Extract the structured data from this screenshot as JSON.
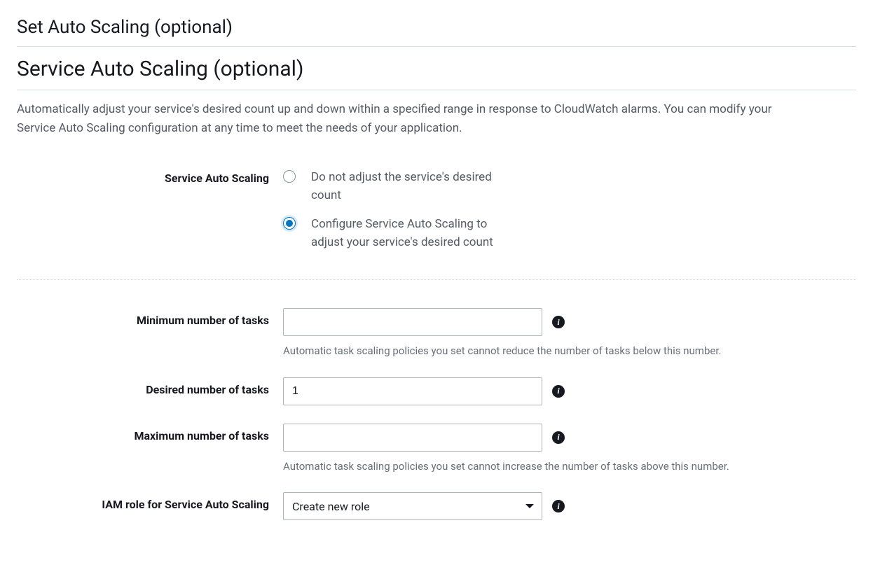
{
  "page_title": "Set Auto Scaling (optional)",
  "section_title": "Service Auto Scaling (optional)",
  "description": "Automatically adjust your service's desired count up and down within a specified range in response to CloudWatch alarms. You can modify your Service Auto Scaling configuration at any time to meet the needs of your application.",
  "labels": {
    "service_auto_scaling": "Service Auto Scaling",
    "min_tasks": "Minimum number of tasks",
    "desired_tasks": "Desired number of tasks",
    "max_tasks": "Maximum number of tasks",
    "iam_role": "IAM role for Service Auto Scaling"
  },
  "radio": {
    "do_not_adjust": "Do not adjust the service's desired count",
    "configure": "Configure Service Auto Scaling to adjust your service's desired count",
    "selected": "configure"
  },
  "fields": {
    "min_tasks_value": "",
    "desired_tasks_value": "1",
    "max_tasks_value": "",
    "iam_role_value": "Create new role"
  },
  "help": {
    "min_tasks": "Automatic task scaling policies you set cannot reduce the number of tasks below this number.",
    "max_tasks": "Automatic task scaling policies you set cannot increase the number of tasks above this number."
  },
  "info_glyph": "i"
}
